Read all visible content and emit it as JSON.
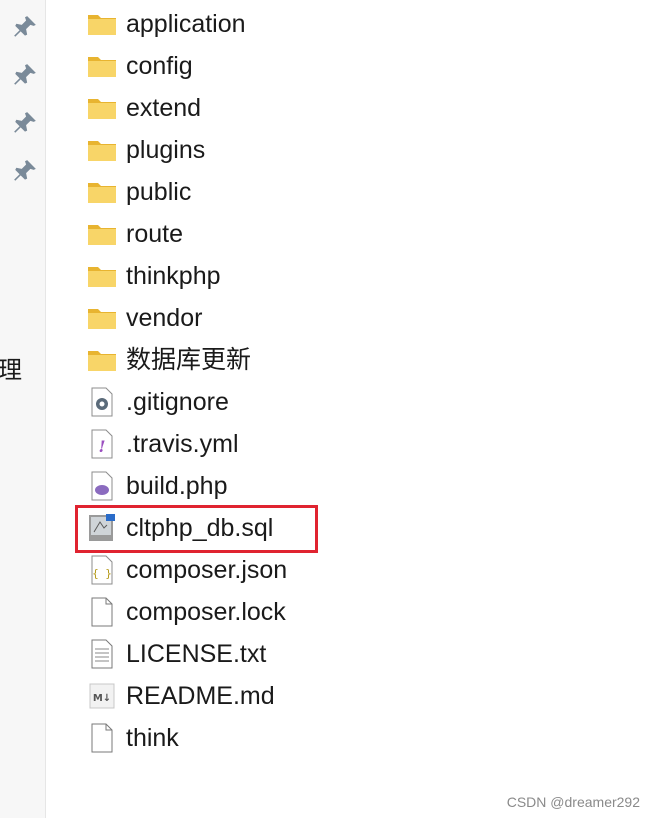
{
  "sidebar": {
    "pins": [
      "pin-icon",
      "pin-icon",
      "pin-icon",
      "pin-icon"
    ],
    "partial_label": "理"
  },
  "files": [
    {
      "name": "application",
      "icon": "folder-icon"
    },
    {
      "name": "config",
      "icon": "folder-icon"
    },
    {
      "name": "extend",
      "icon": "folder-icon"
    },
    {
      "name": "plugins",
      "icon": "folder-icon"
    },
    {
      "name": "public",
      "icon": "folder-icon"
    },
    {
      "name": "route",
      "icon": "folder-icon"
    },
    {
      "name": "thinkphp",
      "icon": "folder-icon"
    },
    {
      "name": "vendor",
      "icon": "folder-icon"
    },
    {
      "name": "数据库更新",
      "icon": "folder-icon"
    },
    {
      "name": ".gitignore",
      "icon": "gear-file-icon"
    },
    {
      "name": ".travis.yml",
      "icon": "yaml-file-icon"
    },
    {
      "name": "build.php",
      "icon": "php-file-icon"
    },
    {
      "name": "cltphp_db.sql",
      "icon": "sql-file-icon",
      "highlighted": true
    },
    {
      "name": "composer.json",
      "icon": "json-file-icon"
    },
    {
      "name": "composer.lock",
      "icon": "blank-file-icon"
    },
    {
      "name": "LICENSE.txt",
      "icon": "text-file-icon"
    },
    {
      "name": "README.md",
      "icon": "markdown-file-icon"
    },
    {
      "name": "think",
      "icon": "blank-file-icon"
    }
  ],
  "colors": {
    "folder": "#f5c542",
    "highlight_border": "#e02330"
  },
  "watermark": "CSDN @dreamer292"
}
